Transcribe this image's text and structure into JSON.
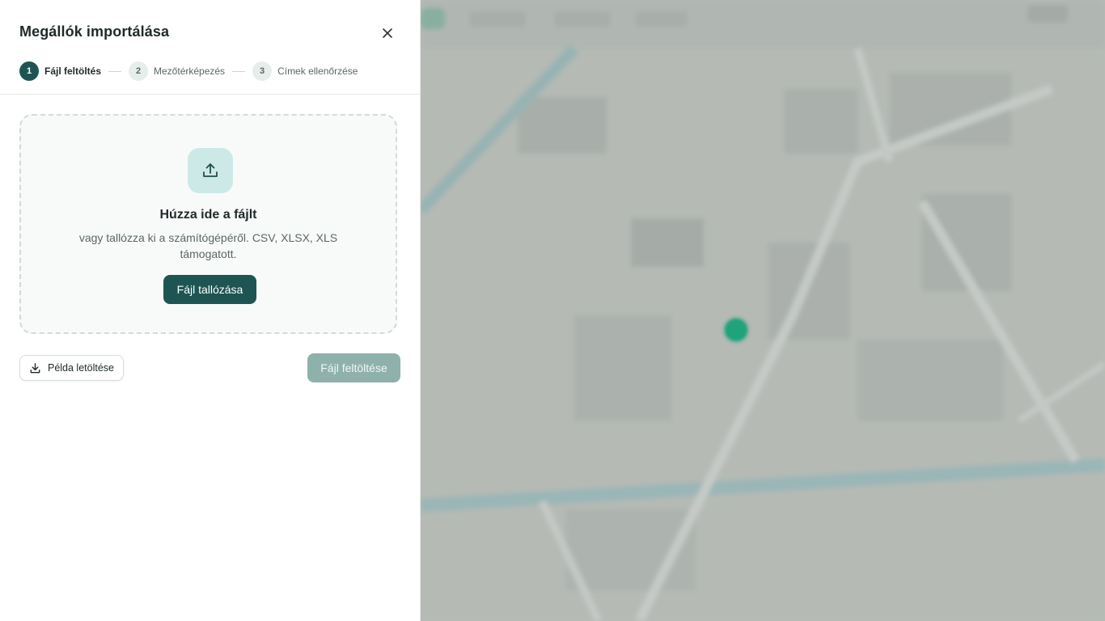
{
  "panel": {
    "title": "Megállók importálása",
    "steps": [
      {
        "number": "1",
        "label": "Fájl feltöltés",
        "active": true
      },
      {
        "number": "2",
        "label": "Mezőtérképezés",
        "active": false
      },
      {
        "number": "3",
        "label": "Címek ellenőrzése",
        "active": false
      }
    ],
    "dropzone": {
      "title": "Húzza ide a fájlt",
      "subtitle": "vagy tallózza ki a számítógépéről. CSV, XLSX, XLS támogatott.",
      "browse_label": "Fájl tallózása"
    },
    "sample_label": "Példa letöltése",
    "upload_label": "Fájl feltöltése"
  },
  "icons": {
    "close": "close-icon",
    "upload": "upload-icon",
    "download": "download-icon"
  },
  "colors": {
    "primary": "#1e5552",
    "primary_disabled": "#8fb1ac",
    "accent_tile": "#cde9e7",
    "map_marker": "#1fa37a"
  }
}
